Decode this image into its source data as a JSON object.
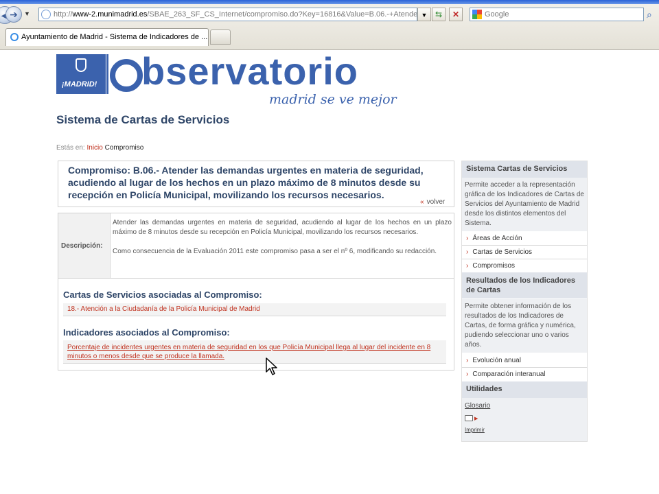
{
  "browser": {
    "url_prefix": "http://",
    "url_host": "www-2.munimadrid.es",
    "url_rest": "/SBAE_263_SF_CS_Internet/compromiso.do?Key=16816&Value=B.06.-+Atende",
    "search_placeholder": "Google",
    "tab_title": "Ayuntamiento de Madrid - Sistema de Indicadores de ..."
  },
  "header": {
    "logo_mark": "¡MADRID!",
    "logo_word": "bservatorio",
    "logo_tagline": "madrid se ve mejor",
    "site_title": "Sistema de Cartas de Servicios"
  },
  "breadcrumb": {
    "prefix": "Estás en:",
    "home": "Inicio",
    "current": "Compromiso"
  },
  "commitment": {
    "title": "Compromiso: B.06.- Atender las demandas urgentes en materia de seguridad, acudiendo al lugar de los hechos en un plazo máximo de 8 minutos desde su recepción en Policía Municipal, movilizando los recursos necesarios.",
    "back_arrow": "«",
    "back_label": "volver"
  },
  "description": {
    "label": "Descripción:",
    "paragraph1": "Atender las demandas urgentes en materia de seguridad, acudiendo al lugar de los hechos en un plazo máximo de 8 minutos desde su recepción en Policía Municipal, movilizando los recursos necesarios.",
    "paragraph2": "Como consecuencia de la Evaluación 2011 este compromiso pasa a ser el nº 6, modificando su redacción."
  },
  "cartas_section": {
    "heading": "Cartas de Servicios asociadas al Compromiso:",
    "links": [
      "18.- Atención a la Ciudadanía de la Policía Municipal de Madrid"
    ]
  },
  "indicadores_section": {
    "heading": "Indicadores asociados al Compromiso:",
    "links": [
      "Porcentaje de incidentes urgentes en materia de seguridad en los que Policía Municipal llega al lugar del incidente en 8 minutos o menos desde que se produce la llamada."
    ]
  },
  "sidebar": {
    "sistema": {
      "title": "Sistema Cartas de Servicios",
      "text": "Permite acceder a la representación gráfica de los Indicadores de Cartas de Servicios del Ayuntamiento de Madrid desde los distintos elementos del Sistema.",
      "items": [
        "Áreas de Acción",
        "Cartas de Servicios",
        "Compromisos"
      ]
    },
    "resultados": {
      "title": "Resultados de los Indicadores de Cartas",
      "text": "Permite obtener información de los resultados de los Indicadores de Cartas, de forma gráfica y numérica, pudiendo seleccionar uno o varios años.",
      "items": [
        "Evolución anual",
        "Comparación interanual"
      ]
    },
    "utilidades": {
      "title": "Utilidades",
      "glosario": "Glosario",
      "imprimir": "Imprimir"
    }
  },
  "colors": {
    "brand_blue": "#3b62ad",
    "title_navy": "#2f4668",
    "link_red": "#c0321f"
  }
}
